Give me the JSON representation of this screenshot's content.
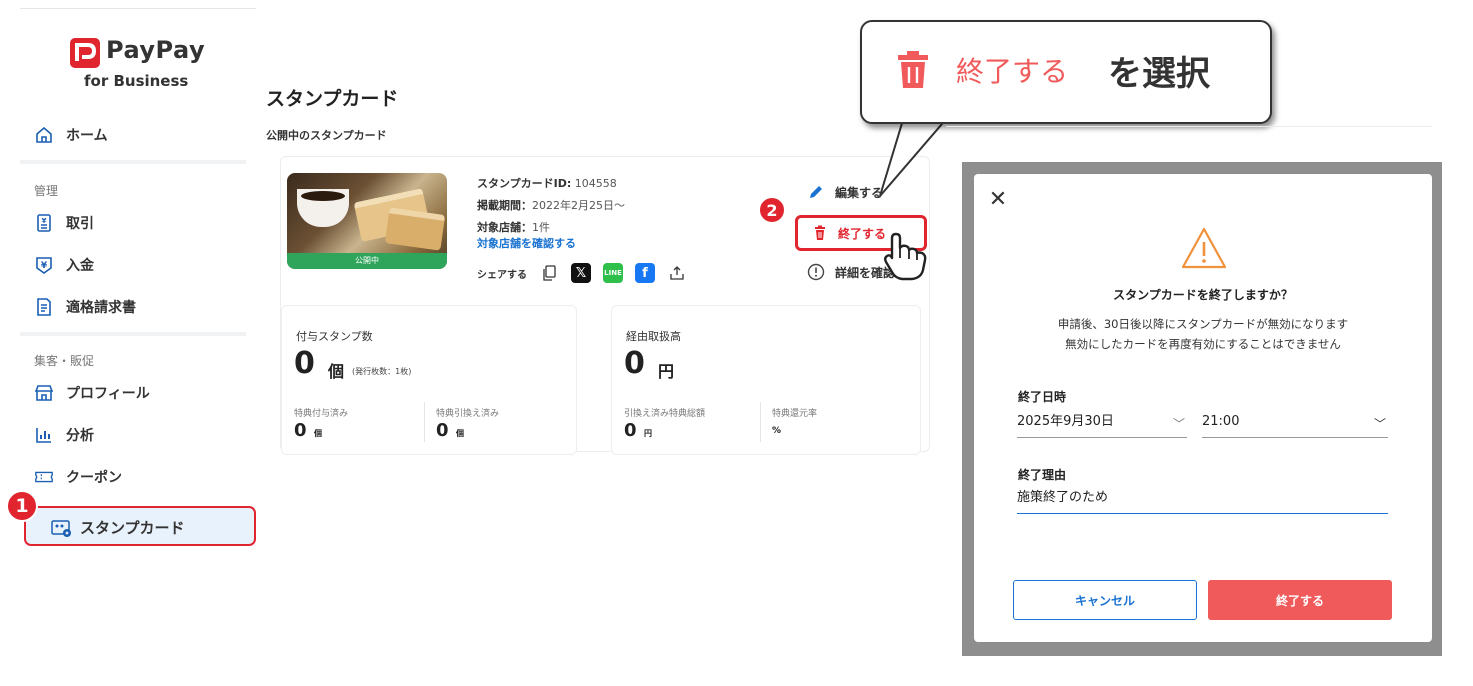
{
  "brand": {
    "name": "PayPay",
    "sub": "for Business"
  },
  "sidebar": {
    "home": "ホーム",
    "section_manage": "管理",
    "manage_items": [
      "取引",
      "入金",
      "適格請求書"
    ],
    "section_sales": "集客・販促",
    "sales_items": [
      "プロフィール",
      "分析",
      "クーポン"
    ],
    "active_item": "スタンプカード"
  },
  "steps": {
    "one": "1",
    "two": "2"
  },
  "main": {
    "title": "スタンプカード",
    "section": "公開中のスタンプカード",
    "card": {
      "status": "公開中",
      "id_label": "スタンプカードID:",
      "id_value": "104558",
      "period_label": "掲載期間：",
      "period_value": "2022年2月25日〜",
      "stores_label": "対象店舗：",
      "stores_value": "1件",
      "stores_link": "対象店舗を確認する",
      "share_label": "シェアする",
      "actions": {
        "edit": "編集する",
        "end": "終了する",
        "detail": "詳細を確認す"
      }
    },
    "stats": {
      "stamps": {
        "title": "付与スタンプ数",
        "value": "0",
        "unit": "個",
        "note": "(発行枚数：1枚)",
        "sub1_label": "特典付与済み",
        "sub1_value": "0",
        "sub1_unit": "個",
        "sub2_label": "特典引換え済み",
        "sub2_value": "0",
        "sub2_unit": "個"
      },
      "amount": {
        "title": "経由取扱高",
        "value": "0",
        "unit": "円",
        "sub1_label": "引換え済み特典総額",
        "sub1_value": "0",
        "sub1_unit": "円",
        "sub2_label": "特典還元率",
        "sub2_value": "%"
      }
    }
  },
  "callout": {
    "action": "終了する",
    "verb": "を選択"
  },
  "modal": {
    "question": "スタンプカードを終了しますか？",
    "desc1": "申請後、30日後以降にスタンプカードが無効になります",
    "desc2": "無効にしたカードを再度有効にすることはできません",
    "end_datetime_label": "終了日時",
    "end_date": "2025年9月30日",
    "end_time": "21:00",
    "reason_label": "終了理由",
    "reason_value": "施策終了のため",
    "cancel": "キャンセル",
    "confirm": "終了する"
  },
  "colors": {
    "accent_red": "#e0252f",
    "link_blue": "#1a73d0",
    "confirm_red": "#f05a5a"
  }
}
